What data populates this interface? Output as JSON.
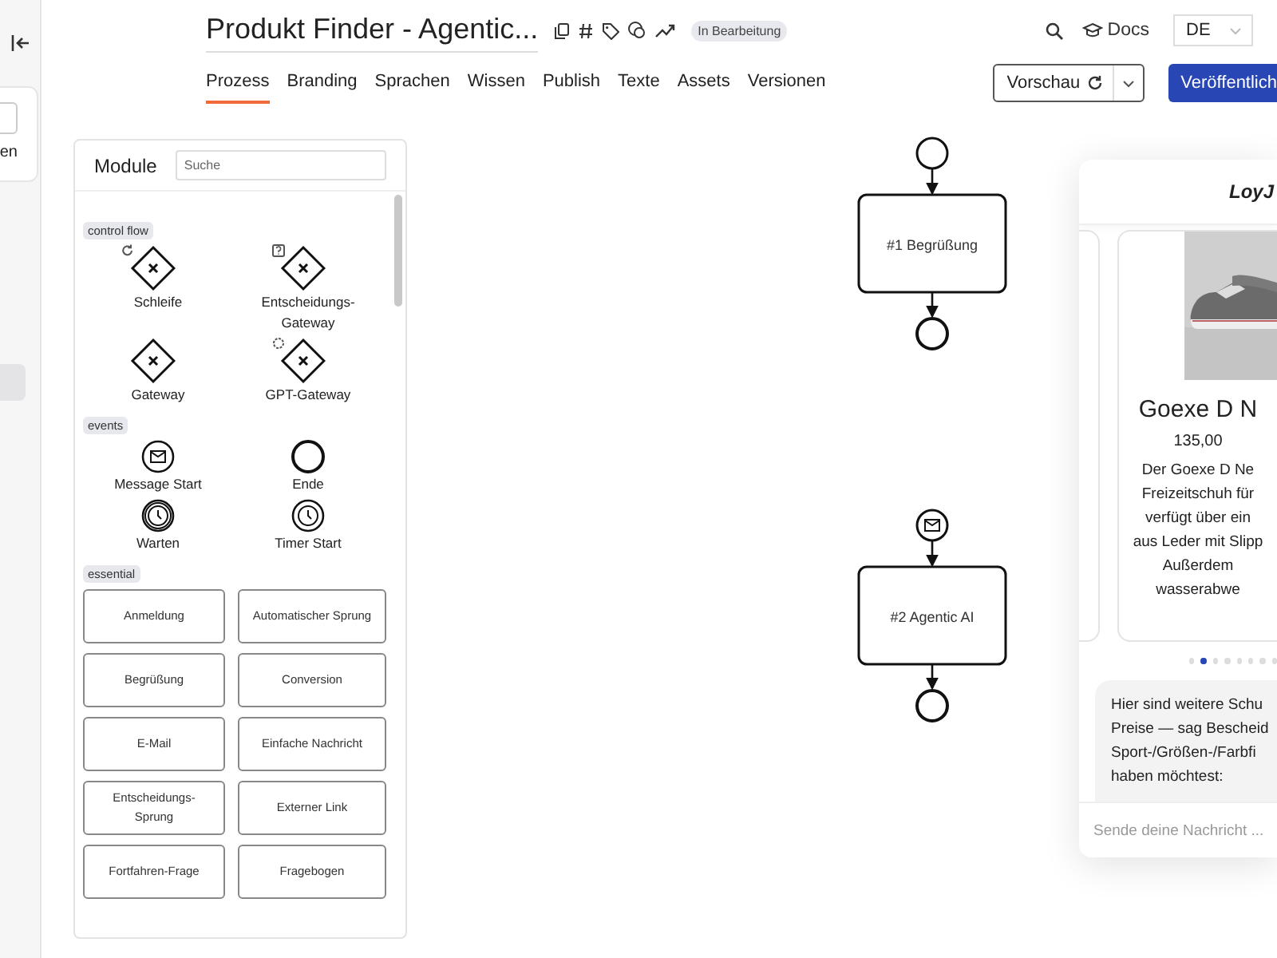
{
  "sidebar": {
    "label": "en"
  },
  "header": {
    "title": "Produkt Finder - Agentic...",
    "status": "In Bearbeitung",
    "docs": "Docs",
    "language": "DE"
  },
  "tabs": [
    {
      "label": "Prozess",
      "selected": true
    },
    {
      "label": "Branding",
      "selected": false
    },
    {
      "label": "Sprachen",
      "selected": false
    },
    {
      "label": "Wissen",
      "selected": false
    },
    {
      "label": "Publish",
      "selected": false
    },
    {
      "label": "Texte",
      "selected": false
    },
    {
      "label": "Assets",
      "selected": false
    },
    {
      "label": "Versionen",
      "selected": false
    }
  ],
  "actions": {
    "preview": "Vorschau",
    "publish": "Veröffentlich"
  },
  "modules": {
    "title": "Module",
    "search": {
      "placeholder": "Suche"
    },
    "groups": [
      {
        "tag": "control flow",
        "items": [
          {
            "kind": "loop",
            "label": "Schleife"
          },
          {
            "kind": "decision",
            "label": "Entscheidungs-Gateway"
          },
          {
            "kind": "gateway",
            "label": "Gateway"
          },
          {
            "kind": "gpt",
            "label": "GPT-Gateway"
          }
        ]
      },
      {
        "tag": "events",
        "items": [
          {
            "kind": "message",
            "label": "Message Start"
          },
          {
            "kind": "end",
            "label": "Ende"
          },
          {
            "kind": "wait",
            "label": "Warten"
          },
          {
            "kind": "timer",
            "label": "Timer Start"
          }
        ]
      },
      {
        "tag": "essential",
        "items": [
          {
            "kind": "block",
            "label": "Anmeldung"
          },
          {
            "kind": "block",
            "label": "Automatischer Sprung"
          },
          {
            "kind": "block",
            "label": "Begrüßung"
          },
          {
            "kind": "block",
            "label": "Conversion"
          },
          {
            "kind": "block",
            "label": "E-Mail"
          },
          {
            "kind": "block",
            "label": "Einfache Nachricht"
          },
          {
            "kind": "block",
            "label": "Entscheidungs-Sprung"
          },
          {
            "kind": "block",
            "label": "Externer Link"
          },
          {
            "kind": "block",
            "label": "Fortfahren-Frage"
          },
          {
            "kind": "block",
            "label": "Fragebogen"
          }
        ]
      }
    ]
  },
  "flows": [
    {
      "kind": "plain",
      "task": "#1 Begrüßung"
    },
    {
      "kind": "message",
      "task": "#2 Agentic AI"
    }
  ],
  "preview": {
    "brand": "LoyJ",
    "product": {
      "title": "Goexe D N",
      "price": "135,00",
      "description": [
        "Der Goexe D Ne",
        "Freizeitschuh für",
        "verfügt über ein",
        "aus Leder mit Slipp",
        "Außerdem",
        "wasserabwe"
      ]
    },
    "dots": [
      {
        "selected": false
      },
      {
        "selected": true
      },
      {
        "selected": false
      },
      {
        "selected": false
      },
      {
        "selected": false
      },
      {
        "selected": false
      },
      {
        "selected": false
      },
      {
        "selected": false
      }
    ],
    "message": [
      "Hier sind weitere Schu",
      "Preise — sag Bescheid",
      "Sport-/Größen-/Farbfi",
      "haben möchtest:"
    ],
    "input": {
      "placeholder": "Sende deine Nachricht ..."
    }
  }
}
